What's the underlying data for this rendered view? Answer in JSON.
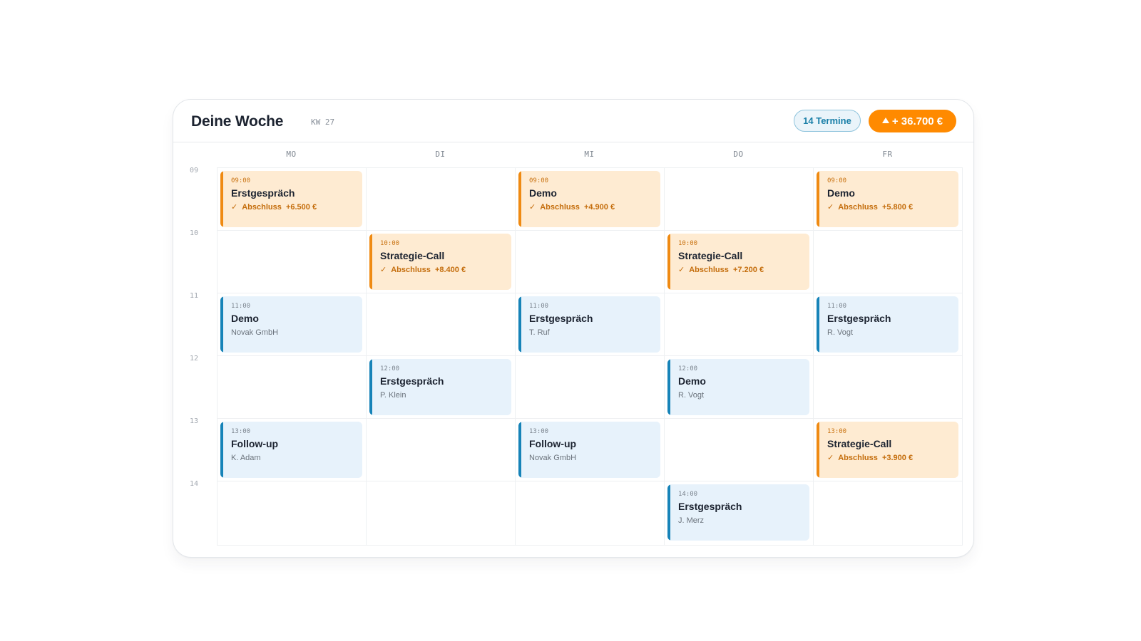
{
  "header": {
    "title": "Deine Woche",
    "week": "KW 27",
    "appointments_badge": "14 Termine",
    "revenue_badge": "+ 36.700 €"
  },
  "days": [
    "MO",
    "DI",
    "MI",
    "DO",
    "FR"
  ],
  "hours": [
    "09",
    "10",
    "11",
    "12",
    "13",
    "14"
  ],
  "colors": {
    "accent_orange": "#ff8a00",
    "deal_bar": "#ef8a12",
    "deal_bg": "#feebd2",
    "meeting_bar": "#1683b8",
    "meeting_bg": "#e7f2fb"
  },
  "events": [
    {
      "day": 0,
      "hour": 0,
      "type": "deal",
      "time": "09:00",
      "title": "Erstgespräch",
      "check": "✓",
      "sub": "Abschluss  +6.500 €"
    },
    {
      "day": 2,
      "hour": 0,
      "type": "deal",
      "time": "09:00",
      "title": "Demo",
      "check": "✓",
      "sub": "Abschluss  +4.900 €"
    },
    {
      "day": 4,
      "hour": 0,
      "type": "deal",
      "time": "09:00",
      "title": "Demo",
      "check": "✓",
      "sub": "Abschluss  +5.800 €"
    },
    {
      "day": 1,
      "hour": 1,
      "type": "deal",
      "time": "10:00",
      "title": "Strategie-Call",
      "check": "✓",
      "sub": "Abschluss  +8.400 €"
    },
    {
      "day": 3,
      "hour": 1,
      "type": "deal",
      "time": "10:00",
      "title": "Strategie-Call",
      "check": "✓",
      "sub": "Abschluss  +7.200 €"
    },
    {
      "day": 0,
      "hour": 2,
      "type": "meet",
      "time": "11:00",
      "title": "Demo",
      "check": "",
      "sub": "Novak GmbH"
    },
    {
      "day": 2,
      "hour": 2,
      "type": "meet",
      "time": "11:00",
      "title": "Erstgespräch",
      "check": "",
      "sub": "T. Ruf"
    },
    {
      "day": 4,
      "hour": 2,
      "type": "meet",
      "time": "11:00",
      "title": "Erstgespräch",
      "check": "",
      "sub": "R. Vogt"
    },
    {
      "day": 1,
      "hour": 3,
      "type": "meet",
      "time": "12:00",
      "title": "Erstgespräch",
      "check": "",
      "sub": "P. Klein"
    },
    {
      "day": 3,
      "hour": 3,
      "type": "meet",
      "time": "12:00",
      "title": "Demo",
      "check": "",
      "sub": "R. Vogt"
    },
    {
      "day": 0,
      "hour": 4,
      "type": "meet",
      "time": "13:00",
      "title": "Follow-up",
      "check": "",
      "sub": "K. Adam"
    },
    {
      "day": 2,
      "hour": 4,
      "type": "meet",
      "time": "13:00",
      "title": "Follow-up",
      "check": "",
      "sub": "Novak GmbH"
    },
    {
      "day": 4,
      "hour": 4,
      "type": "deal",
      "time": "13:00",
      "title": "Strategie-Call",
      "check": "✓",
      "sub": "Abschluss  +3.900 €"
    },
    {
      "day": 3,
      "hour": 5,
      "type": "meet",
      "time": "14:00",
      "title": "Erstgespräch",
      "check": "",
      "sub": "J. Merz"
    }
  ]
}
